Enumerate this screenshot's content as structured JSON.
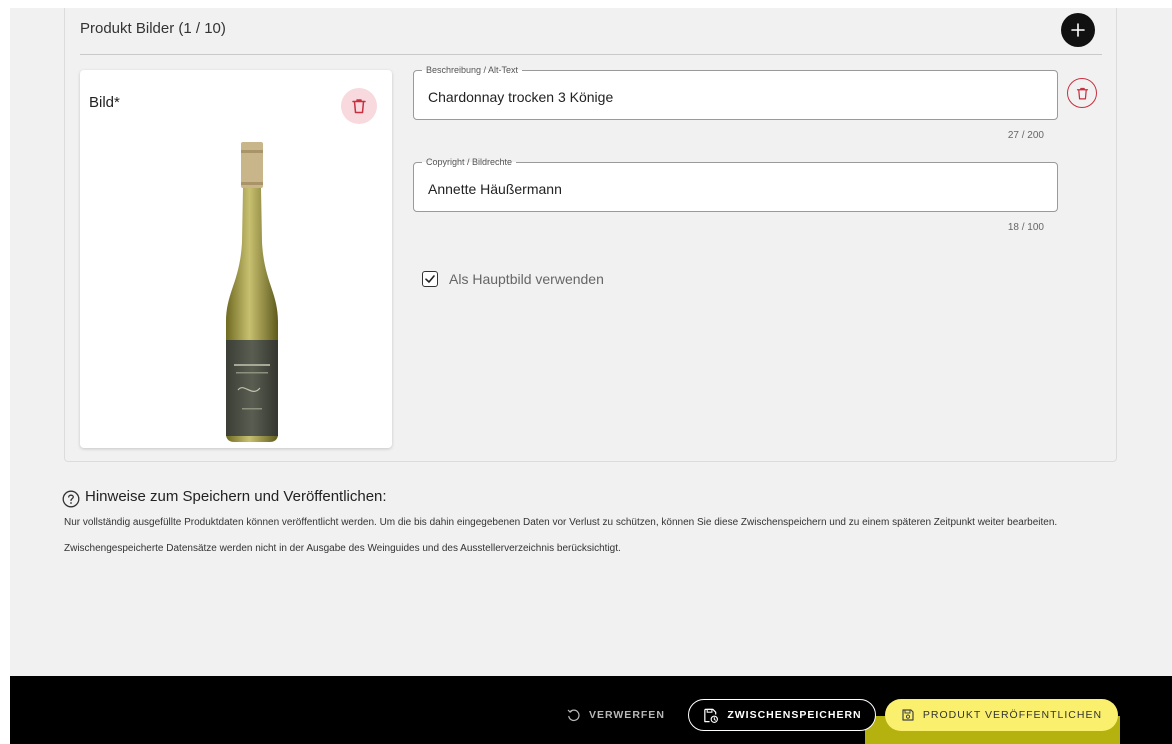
{
  "section": {
    "title": "Produkt Bilder (1 / 10)",
    "add_icon": "plus-icon"
  },
  "image_card": {
    "label": "Bild*",
    "delete_icon": "trash-icon"
  },
  "form": {
    "description": {
      "legend": "Beschreibung / Alt-Text",
      "value": "Chardonnay trocken 3 Könige",
      "counter": "27 / 200"
    },
    "copyright": {
      "legend": "Copyright / Bildrechte",
      "value": "Annette Häußermann",
      "counter": "18 / 100"
    },
    "main_image": {
      "label": "Als Hauptbild verwenden",
      "checked": true
    }
  },
  "help": {
    "icon": "question-circle-icon",
    "title": "Hinweise zum Speichern und Veröffentlichen:",
    "text": "Nur vollständig ausgefüllte Produktdaten können veröffentlicht werden. Um die bis dahin eingegebenen Daten vor Verlust zu schützen, können Sie diese Zwischenspeichern und zu einem späteren Zeitpunkt weiter bearbeiten. Zwischengespeicherte Datensätze werden nicht in der Ausgabe des Weinguides und des Ausstellerverzeichnis berücksichtigt."
  },
  "actions": {
    "discard": "VERWERFEN",
    "save_draft": "ZWISCHENSPEICHERN",
    "publish": "PRODUKT VERÖFFENTLICHEN"
  },
  "colors": {
    "accent_yellow": "#faf06e",
    "delete_red": "#c9303f",
    "bar_black": "#000000"
  }
}
